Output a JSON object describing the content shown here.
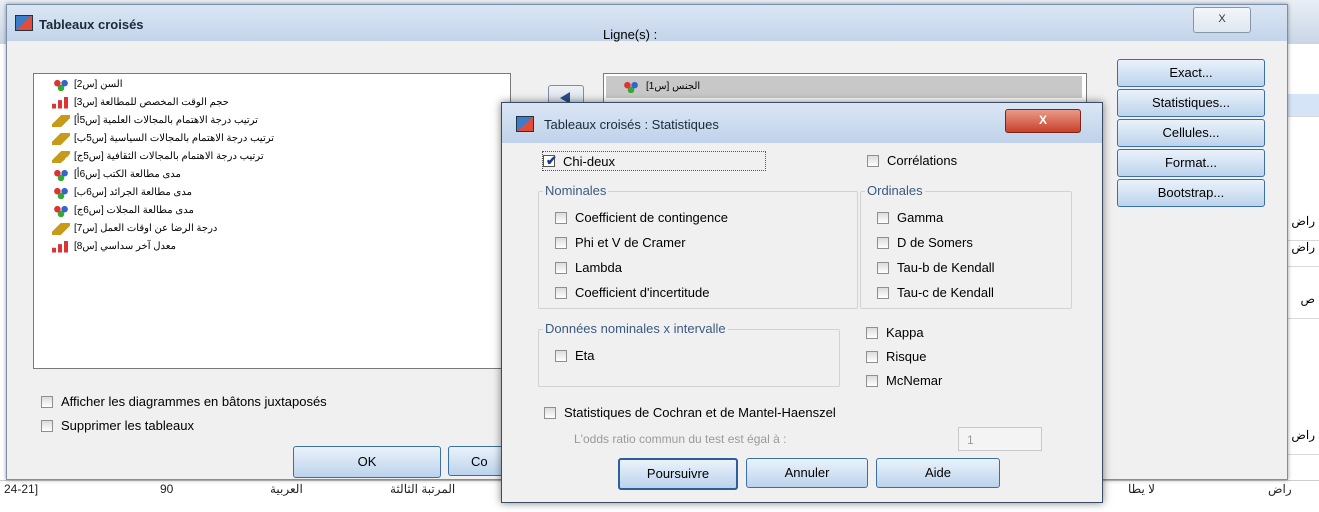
{
  "main_dialog": {
    "title": "Tableaux croisés",
    "close_label": "X",
    "variables": [
      {
        "label": "السن [س2]",
        "icon": "nominal-icon"
      },
      {
        "label": "حجم الوقت المخصص للمطالعة [س3]",
        "icon": "scale-icon"
      },
      {
        "label": "ترتيب درجة الاهتمام بالمجالات العلمية [س5أ]",
        "icon": "ordinal-icon"
      },
      {
        "label": "ترتيب درجة الاهتمام بالمجالات السياسية [س5ب]",
        "icon": "ordinal-icon"
      },
      {
        "label": "ترتيب درجة الاهتمام بالمجالات الثقافية [س5ج]",
        "icon": "ordinal-icon"
      },
      {
        "label": "مدى مطالعة الكتب [س6أ]",
        "icon": "nominal-icon"
      },
      {
        "label": "مدى مطالعة الجرائد [س6ب]",
        "icon": "nominal-icon"
      },
      {
        "label": "مدى مطالعة المجلات [س6ج]",
        "icon": "nominal-icon"
      },
      {
        "label": "درجة الرضا عن اوقات العمل [س7]",
        "icon": "ordinal-icon"
      },
      {
        "label": "معدل آخر سداسي [س8]",
        "icon": "scale-icon"
      }
    ],
    "ligne_label": "Ligne(s) :",
    "ligne_item": "الجنس [س1]",
    "side_buttons": [
      "Exact...",
      "Statistiques...",
      "Cellules...",
      "Format...",
      "Bootstrap..."
    ],
    "check_barchart": "Afficher les diagrammes en bâtons juxtaposés",
    "check_suppress": "Supprimer les tableaux",
    "ok_label": "OK",
    "co_label": "Co"
  },
  "stat_dialog": {
    "title": "Tableaux croisés : Statistiques",
    "close_label": "X",
    "chi": "Chi-deux",
    "correlations": "Corrélations",
    "nominal_group": "Nominales",
    "nominal_items": [
      "Coefficient de contingence",
      "Phi et V de Cramer",
      "Lambda",
      "Coefficient d'incertitude"
    ],
    "ordinal_group": "Ordinales",
    "ordinal_items": [
      "Gamma",
      "D de Somers",
      "Tau-b de Kendall",
      "Tau-c de Kendall"
    ],
    "interval_group": "Données nominales x intervalle",
    "eta": "Eta",
    "kappa": "Kappa",
    "risque": "Risque",
    "mcnemar": "McNemar",
    "cochran": "Statistiques de Cochran et de Mantel-Haenszel",
    "odds_label": "L'odds ratio commun du test est égal à :",
    "odds_value": "1",
    "btn_continue": "Poursuivre",
    "btn_cancel": "Annuler",
    "btn_help": "Aide"
  },
  "background": {
    "right_cells": [
      "راض",
      "راض",
      "ص",
      "راض"
    ],
    "bottom_cells": [
      "24-21]",
      "90",
      "العربية",
      "المرتبة الثالثة",
      "لا يطا",
      "راض"
    ]
  }
}
